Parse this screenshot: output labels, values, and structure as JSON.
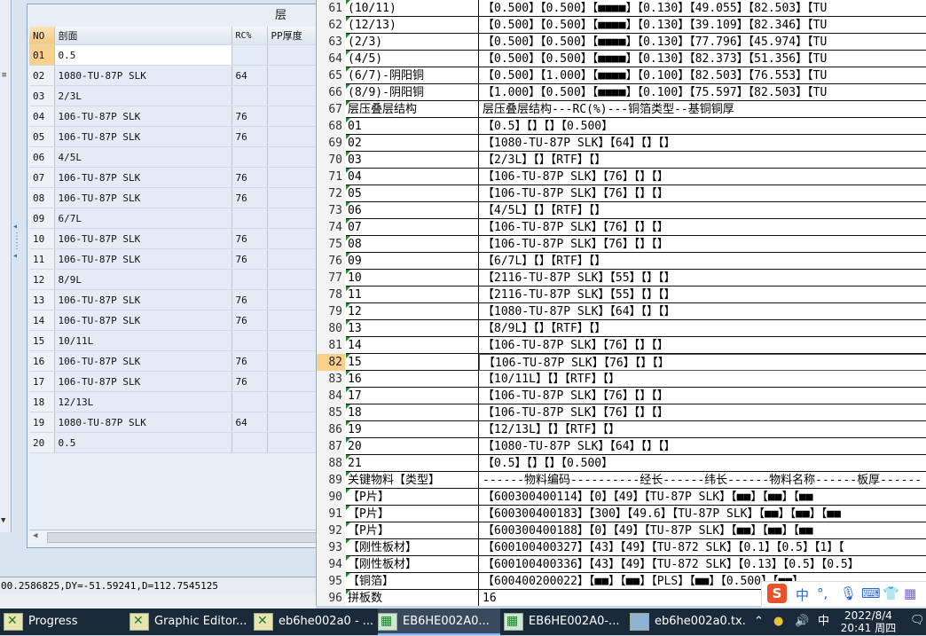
{
  "left_panel": {
    "title": "层",
    "columns": [
      "NO",
      "剖面",
      "RC%",
      "PP厚度"
    ],
    "rows": [
      {
        "no": "01",
        "section": "0.5",
        "rc": "",
        "selected": true
      },
      {
        "no": "02",
        "section": "1080-TU-87P SLK",
        "rc": "64"
      },
      {
        "no": "03",
        "section": "2/3L",
        "rc": ""
      },
      {
        "no": "04",
        "section": "106-TU-87P SLK",
        "rc": "76"
      },
      {
        "no": "05",
        "section": "106-TU-87P SLK",
        "rc": "76"
      },
      {
        "no": "06",
        "section": "4/5L",
        "rc": ""
      },
      {
        "no": "07",
        "section": "106-TU-87P SLK",
        "rc": "76"
      },
      {
        "no": "08",
        "section": "106-TU-87P SLK",
        "rc": "76"
      },
      {
        "no": "09",
        "section": "6/7L",
        "rc": ""
      },
      {
        "no": "10",
        "section": "106-TU-87P SLK",
        "rc": "76"
      },
      {
        "no": "11",
        "section": "106-TU-87P SLK",
        "rc": "76"
      },
      {
        "no": "12",
        "section": "8/9L",
        "rc": ""
      },
      {
        "no": "13",
        "section": "106-TU-87P SLK",
        "rc": "76"
      },
      {
        "no": "14",
        "section": "106-TU-87P SLK",
        "rc": "76"
      },
      {
        "no": "15",
        "section": "10/11L",
        "rc": ""
      },
      {
        "no": "16",
        "section": "106-TU-87P SLK",
        "rc": "76"
      },
      {
        "no": "17",
        "section": "106-TU-87P SLK",
        "rc": "76"
      },
      {
        "no": "18",
        "section": "12/13L",
        "rc": ""
      },
      {
        "no": "19",
        "section": "1080-TU-87P SLK",
        "rc": "64"
      },
      {
        "no": "20",
        "section": "0.5",
        "rc": ""
      }
    ],
    "status_text": "00.2586825,DY=-51.59241,D=112.7545125"
  },
  "editor": {
    "current_line": "82",
    "lines": [
      {
        "n": "61",
        "a": "(10/11)",
        "b": "【0.500】【0.500】【■■■■】【0.130】【49.055】【82.503】【TU"
      },
      {
        "n": "62",
        "a": "(12/13)",
        "b": "【0.500】【0.500】【■■■■】【0.130】【39.109】【82.346】【TU"
      },
      {
        "n": "63",
        "a": "(2/3)",
        "b": "【0.500】【0.500】【■■■■】【0.130】【77.796】【45.974】【TU"
      },
      {
        "n": "64",
        "a": "(4/5)",
        "b": "【0.500】【0.500】【■■■■】【0.130】【82.373】【51.356】【TU"
      },
      {
        "n": "65",
        "a": "(6/7)-阴阳铜",
        "b": "【0.500】【1.000】【■■■■】【0.100】【82.503】【76.553】【TU",
        "small": true
      },
      {
        "n": "66",
        "a": "(8/9)-阴阳铜",
        "b": "【1.000】【0.500】【■■■■】【0.100】【75.597】【82.503】【TU",
        "small": true
      },
      {
        "n": "67",
        "a": "层压叠层结构",
        "b": "层压叠层结构---RC(%)---铜箔类型--基铜铜厚"
      },
      {
        "n": "68",
        "a": "01",
        "b": "【0.5】【】【】【0.500】"
      },
      {
        "n": "69",
        "a": "02",
        "b": "【1080-TU-87P SLK】【64】【】【】"
      },
      {
        "n": "70",
        "a": "03",
        "b": "【2/3L】【】【RTF】【】"
      },
      {
        "n": "71",
        "a": "04",
        "b": "【106-TU-87P SLK】【76】【】【】"
      },
      {
        "n": "72",
        "a": "05",
        "b": "【106-TU-87P SLK】【76】【】【】"
      },
      {
        "n": "73",
        "a": "06",
        "b": "【4/5L】【】【RTF】【】"
      },
      {
        "n": "74",
        "a": "07",
        "b": "【106-TU-87P SLK】【76】【】【】"
      },
      {
        "n": "75",
        "a": "08",
        "b": "【106-TU-87P SLK】【76】【】【】"
      },
      {
        "n": "76",
        "a": "09",
        "b": "【6/7L】【】【RTF】【】"
      },
      {
        "n": "77",
        "a": "10",
        "b": "【2116-TU-87P SLK】【55】【】【】"
      },
      {
        "n": "78",
        "a": "11",
        "b": "【2116-TU-87P SLK】【55】【】【】"
      },
      {
        "n": "79",
        "a": "12",
        "b": "【1080-TU-87P SLK】【64】【】【】"
      },
      {
        "n": "80",
        "a": "13",
        "b": "【8/9L】【】【RTF】【】"
      },
      {
        "n": "81",
        "a": "14",
        "b": "【106-TU-87P SLK】【76】【】【】"
      },
      {
        "n": "82",
        "a": "15",
        "b": "【106-TU-87P SLK】【76】【】【】"
      },
      {
        "n": "83",
        "a": "16",
        "b": "【10/11L】【】【RTF】【】"
      },
      {
        "n": "84",
        "a": "17",
        "b": "【106-TU-87P SLK】【76】【】【】"
      },
      {
        "n": "85",
        "a": "18",
        "b": "【106-TU-87P SLK】【76】【】【】"
      },
      {
        "n": "86",
        "a": "19",
        "b": "【12/13L】【】【RTF】【】"
      },
      {
        "n": "87",
        "a": "20",
        "b": "【1080-TU-87P SLK】【64】【】【】"
      },
      {
        "n": "88",
        "a": "21",
        "b": "【0.5】【】【】【0.500】"
      },
      {
        "n": "89",
        "a": "关键物料【类型】",
        "b": "------物料编码----------经长------纬长------物料名称------板厚------"
      },
      {
        "n": "90",
        "a": "【P片】",
        "b": "【600300400114】【0】【49】【TU-87P SLK】【■■】【■■】【■■"
      },
      {
        "n": "91",
        "a": "【P片】",
        "b": "【600300400183】【300】【49.6】【TU-87P SLK】【■■】【■■】【■■"
      },
      {
        "n": "92",
        "a": "【P片】",
        "b": "【600300400188】【0】【49】【TU-87P SLK】【■■】【■■】【■■"
      },
      {
        "n": "93",
        "a": "【刚性板材】",
        "b": "【600100400327】【43】【49】【TU-872 SLK】【0.1】【0.5】【1】【"
      },
      {
        "n": "94",
        "a": "【刚性板材】",
        "b": "【600100400336】【43】【49】【TU-872 SLK】【0.13】【0.5】【0.5】"
      },
      {
        "n": "95",
        "a": "【铜箔】",
        "b": "【600400200022】【■■】【■■】【PLS】【■■】【0.500】【■■】"
      },
      {
        "n": "96",
        "a": "拼板数",
        "b": "16"
      }
    ]
  },
  "taskbar": {
    "items": [
      {
        "label": "Progress",
        "icon": "x"
      },
      {
        "label": "Graphic Editor...",
        "icon": "x"
      },
      {
        "label": "eb6he002a0 - ...",
        "icon": "x"
      },
      {
        "label": "EB6HE002A0...",
        "icon": "xl",
        "active": true
      },
      {
        "label": "EB6HE002A0-...",
        "icon": "xl"
      },
      {
        "label": "eb6he002a0.tx...",
        "icon": "nb"
      }
    ],
    "tray_lang": "中",
    "clock_date": "2022/8/4",
    "clock_time": "20:41 周四",
    "ime": {
      "logo": "S",
      "mode": "中"
    }
  },
  "colors": {
    "accent_current_line": "#fbd08b",
    "taskbar_bg": "#1b2a3a"
  }
}
